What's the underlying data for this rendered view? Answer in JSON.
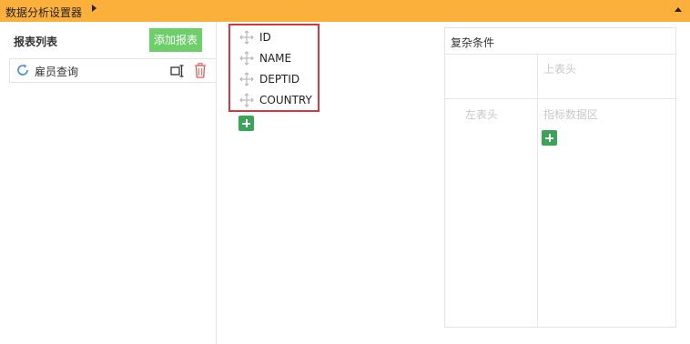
{
  "window": {
    "title": "数据分析设置器"
  },
  "report_list": {
    "heading": "报表列表",
    "add_button": "添加报表",
    "items": [
      {
        "label": "雇员查询"
      }
    ]
  },
  "fields": [
    {
      "name": "ID"
    },
    {
      "name": "NAME"
    },
    {
      "name": "DEPTID"
    },
    {
      "name": "COUNTRY"
    }
  ],
  "complex_condition": {
    "heading": "复杂条件",
    "top_header_placeholder": "上表头",
    "left_header_placeholder": "左表头",
    "data_area_placeholder": "指标数据区"
  },
  "icons": {
    "titlebar_right": "caret-right-icon",
    "titlebar_collapse": "caret-up-icon",
    "refresh": "refresh-icon",
    "rename": "rename-icon",
    "delete": "trash-icon",
    "drag": "move-icon",
    "add": "plus-icon"
  },
  "colors": {
    "titlebar": "#fbb03b",
    "add_button": "#6ccf6a",
    "plus_button": "#3aa458",
    "highlight_border": "#d9363e",
    "delete_icon": "#e05a4f",
    "refresh_icon": "#3f8ed8"
  }
}
